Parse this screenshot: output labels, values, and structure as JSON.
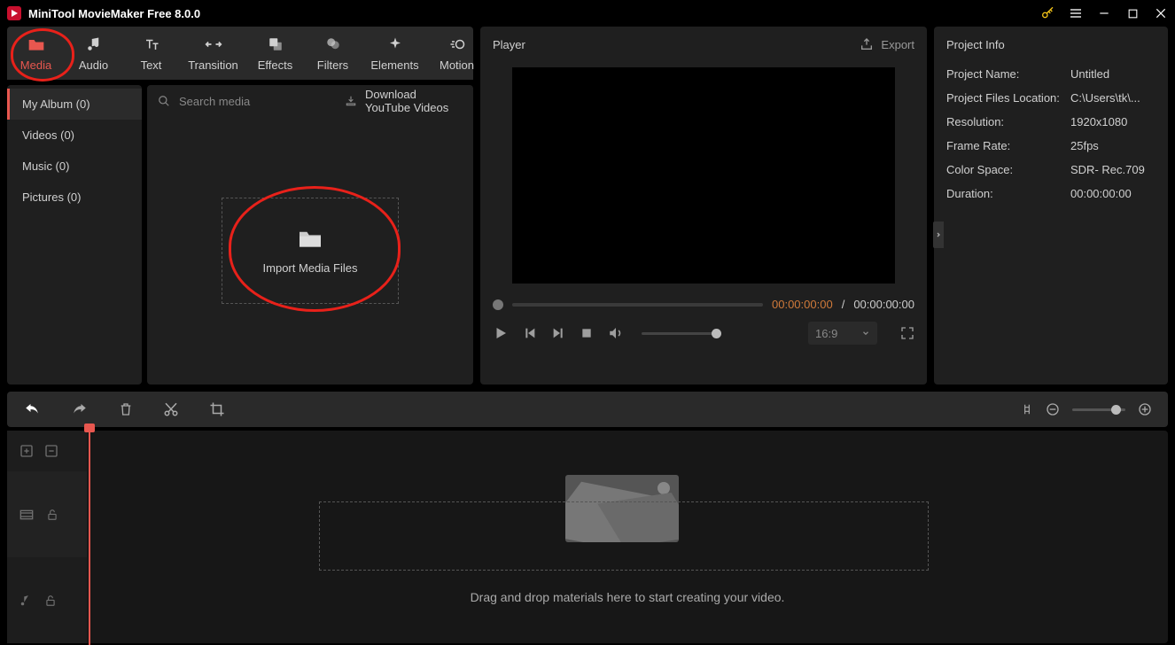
{
  "title": "MiniTool MovieMaker Free 8.0.0",
  "tabs": {
    "media": "Media",
    "audio": "Audio",
    "text": "Text",
    "transition": "Transition",
    "effects": "Effects",
    "filters": "Filters",
    "elements": "Elements",
    "motion": "Motion"
  },
  "categories": {
    "album": "My Album (0)",
    "videos": "Videos (0)",
    "music": "Music (0)",
    "pictures": "Pictures (0)"
  },
  "search": {
    "placeholder": "Search media"
  },
  "downloadYT": "Download YouTube Videos",
  "importLabel": "Import Media Files",
  "player": {
    "title": "Player",
    "export": "Export"
  },
  "time": {
    "current": "00:00:00:00",
    "sep": "/",
    "total": "00:00:00:00"
  },
  "ratio": "16:9",
  "projectInfo": {
    "title": "Project Info",
    "rows": {
      "name": {
        "k": "Project Name:",
        "v": "Untitled"
      },
      "loc": {
        "k": "Project Files Location:",
        "v": "C:\\Users\\tk\\..."
      },
      "res": {
        "k": "Resolution:",
        "v": "1920x1080"
      },
      "fps": {
        "k": "Frame Rate:",
        "v": "25fps"
      },
      "cs": {
        "k": "Color Space:",
        "v": "SDR- Rec.709"
      },
      "dur": {
        "k": "Duration:",
        "v": "00:00:00:00"
      }
    }
  },
  "dndHint": "Drag and drop materials here to start creating your video."
}
